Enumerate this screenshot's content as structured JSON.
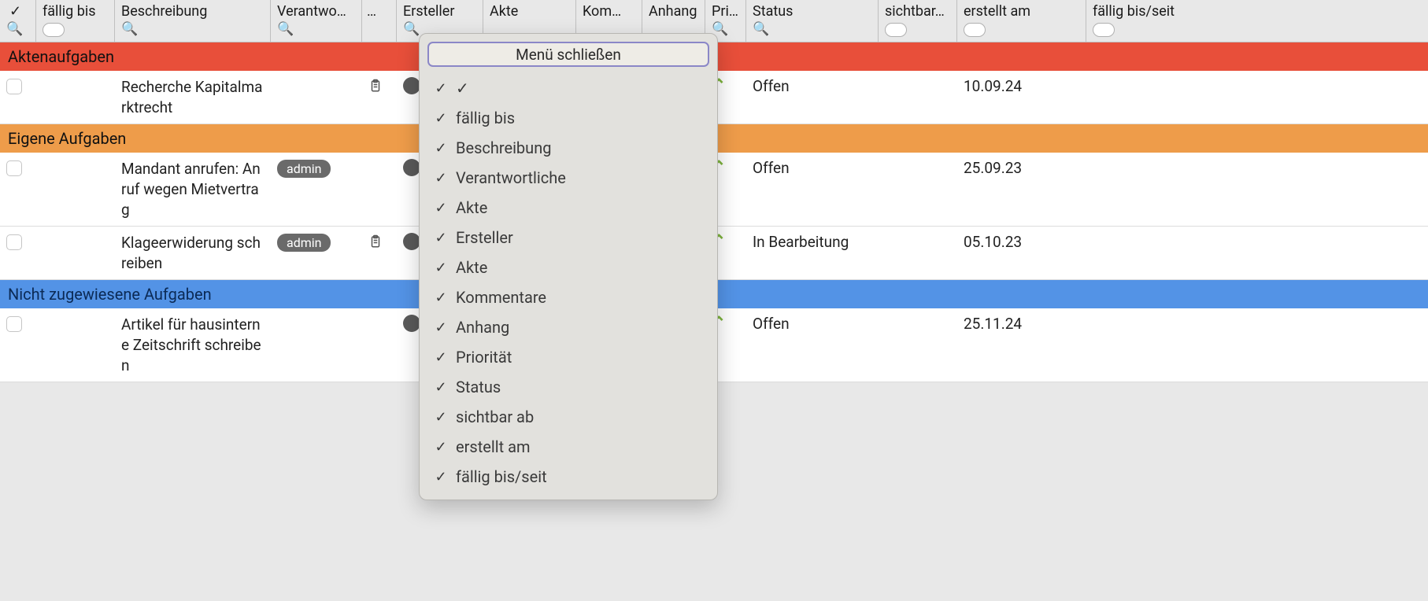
{
  "columns": {
    "check": "✓",
    "due": "fällig bis",
    "desc": "Beschreibung",
    "resp": "Verantwo…",
    "dots": "…",
    "creator": "Ersteller",
    "file": "Akte",
    "comm": "Kom…",
    "att": "Anhang",
    "pri": "Pri…",
    "status": "Status",
    "vis": "sichtbar…",
    "created": "erstellt am",
    "dueseit": "fällig bis/seit"
  },
  "groups": [
    {
      "id": "aktenaufgaben",
      "title": "Aktenaufgaben",
      "color": "red",
      "rows": [
        {
          "desc": "Recherche Kapitalmarktrecht",
          "resp": "",
          "clipboard": true,
          "status": "Offen",
          "created": "10.09.24"
        }
      ]
    },
    {
      "id": "eigene",
      "title": "Eigene Aufgaben",
      "color": "orange",
      "rows": [
        {
          "desc": "Mandant anrufen: Anruf wegen Mietvertrag",
          "resp": "admin",
          "clipboard": false,
          "status": "Offen",
          "created": "25.09.23"
        },
        {
          "desc": "Klageerwiderung schreiben",
          "resp": "admin",
          "clipboard": true,
          "status": "In Bearbeitung",
          "created": "05.10.23"
        }
      ]
    },
    {
      "id": "nichtzugewiesen",
      "title": "Nicht zugewiesene Aufgaben",
      "color": "blue",
      "rows": [
        {
          "desc": "Artikel für hausinterne Zeitschrift schreiben",
          "resp": "",
          "clipboard": false,
          "status": "Offen",
          "created": "25.11.24"
        }
      ]
    }
  ],
  "popup": {
    "close": "Menü schließen",
    "items": [
      "✓",
      "fällig bis",
      "Beschreibung",
      "Verantwortliche",
      "Akte",
      "Ersteller",
      "Akte",
      "Kommentare",
      "Anhang",
      "Priorität",
      "Status",
      "sichtbar ab",
      "erstellt am",
      "fällig bis/seit"
    ]
  }
}
